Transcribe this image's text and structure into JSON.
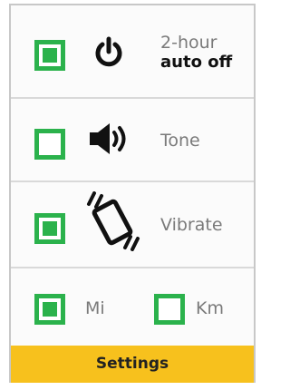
{
  "settings": [
    {
      "id": "auto-off",
      "checked": true,
      "icon": "power-icon",
      "label_line1": "2-hour",
      "label_line2": "auto off"
    },
    {
      "id": "tone",
      "checked": false,
      "icon": "speaker-icon",
      "label": "Tone"
    },
    {
      "id": "vibrate",
      "checked": true,
      "icon": "vibrate-icon",
      "label": "Vibrate"
    }
  ],
  "units": [
    {
      "id": "mi",
      "checked": true,
      "label": "Mi"
    },
    {
      "id": "km",
      "checked": false,
      "label": "Km"
    }
  ],
  "footer": {
    "title": "Settings"
  },
  "colors": {
    "accent_green": "#2bb24c",
    "footer_yellow": "#f7c11d"
  }
}
